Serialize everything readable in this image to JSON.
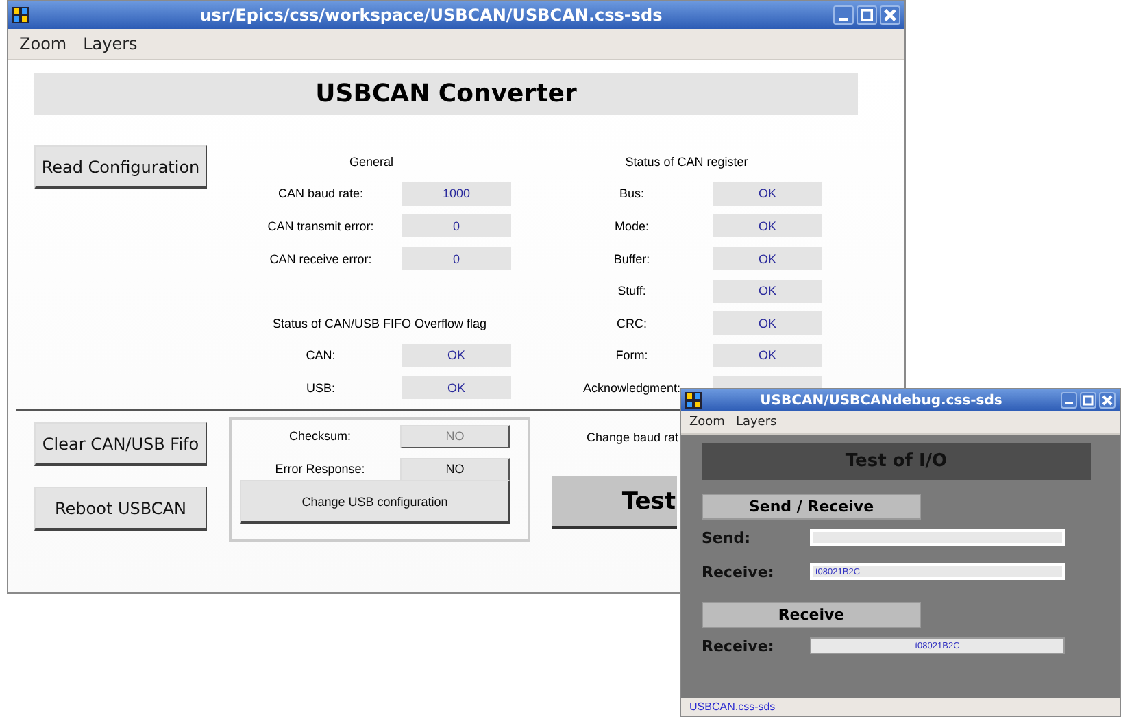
{
  "main_window": {
    "title": "usr/Epics/css/workspace/USBCAN/USBCAN.css-sds",
    "menu": [
      "Zoom",
      "Layers"
    ],
    "heading": "USBCAN Converter",
    "read_button": "Read Configuration",
    "general": {
      "title": "General",
      "rows": [
        {
          "label": "CAN baud rate:",
          "value": "1000"
        },
        {
          "label": "CAN transmit error:",
          "value": "0"
        },
        {
          "label": "CAN receive error:",
          "value": "0"
        }
      ]
    },
    "fifo": {
      "title": "Status of CAN/USB  FIFO Overflow flag",
      "rows": [
        {
          "label": "CAN:",
          "value": "OK"
        },
        {
          "label": "USB:",
          "value": "OK"
        }
      ]
    },
    "can_register": {
      "title": "Status of CAN register",
      "rows": [
        {
          "label": "Bus:",
          "value": "OK"
        },
        {
          "label": "Mode:",
          "value": "OK"
        },
        {
          "label": "Buffer:",
          "value": "OK"
        },
        {
          "label": "Stuff:",
          "value": "OK"
        },
        {
          "label": "CRC:",
          "value": "OK"
        },
        {
          "label": "Form:",
          "value": "OK"
        },
        {
          "label": "Acknowledgment:"
        }
      ]
    },
    "action_buttons": [
      "Clear CAN/USB Fifo",
      "Reboot USBCAN"
    ],
    "usb_config": {
      "rows": [
        {
          "label": "Checksum:",
          "value": "NO",
          "disabled": true
        },
        {
          "label": "Error Response:",
          "value": "NO",
          "disabled": false
        }
      ],
      "button": "Change USB configuration"
    },
    "baud_label": "Change baud rat",
    "test_button": "Test"
  },
  "debug_window": {
    "title": "USBCAN/USBCANdebug.css-sds",
    "menu": [
      "Zoom",
      "Layers"
    ],
    "heading": "Test of I/O",
    "sections": [
      {
        "title": "Send / Receive",
        "rows": [
          {
            "label": "Send:",
            "kind": "entry"
          },
          {
            "label": "Receive:",
            "kind": "entry",
            "value": "t08021B2C"
          }
        ]
      },
      {
        "title": "Receive",
        "rows": [
          {
            "label": "Receive:",
            "kind": "display",
            "value": "t08021B2C"
          }
        ]
      }
    ],
    "status_bar": "USBCAN.css-sds"
  }
}
